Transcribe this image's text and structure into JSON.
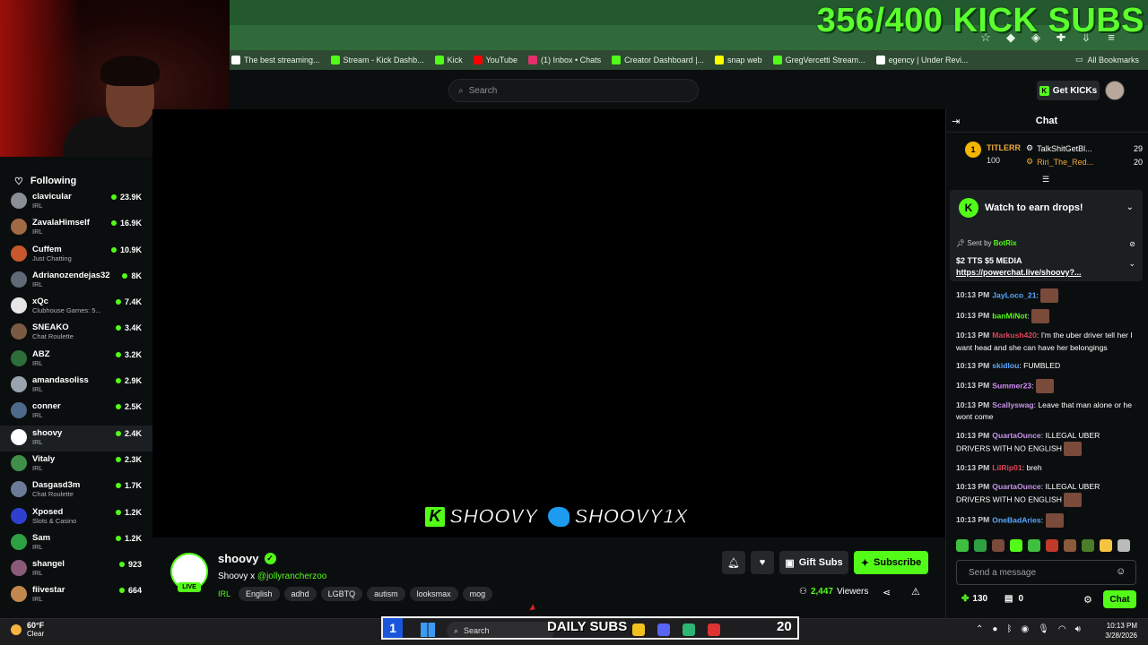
{
  "overlay": {
    "sub_counter": "356/400 KICK SUBS"
  },
  "bookmarks": [
    {
      "label": "The best streaming...",
      "color": "#ffffff"
    },
    {
      "label": "Stream - Kick Dashb...",
      "color": "#53fc18"
    },
    {
      "label": "Kick",
      "color": "#53fc18"
    },
    {
      "label": "YouTube",
      "color": "#ff0000"
    },
    {
      "label": "(1) Inbox • Chats",
      "color": "#e1306c"
    },
    {
      "label": "Creator Dashboard |...",
      "color": "#53fc18"
    },
    {
      "label": "snap web",
      "color": "#fffc00"
    },
    {
      "label": "GregVercetti Stream...",
      "color": "#53fc18"
    },
    {
      "label": "egency | Under Revi...",
      "color": "#ffffff"
    }
  ],
  "bookmarks_all": "All Bookmarks",
  "header": {
    "search_placeholder": "Search",
    "get_kicks": "Get KICKs"
  },
  "sidebar": {
    "heading": "Following",
    "items": [
      {
        "name": "clavicular",
        "category": "IRL",
        "viewers": "23.9K",
        "avatar": "#8a8f95"
      },
      {
        "name": "ZavalaHimself",
        "category": "IRL",
        "viewers": "16.9K",
        "avatar": "#a06a45"
      },
      {
        "name": "Cuffem",
        "category": "Just Chatting",
        "viewers": "10.9K",
        "avatar": "#c7582e"
      },
      {
        "name": "Adrianozendejas32",
        "category": "IRL",
        "viewers": "8K",
        "avatar": "#5e6b77"
      },
      {
        "name": "xQc",
        "category": "Clubhouse Games: 5...",
        "viewers": "7.4K",
        "avatar": "#e6e6e6"
      },
      {
        "name": "SNEAKO",
        "category": "Chat Roulette",
        "viewers": "3.4K",
        "avatar": "#7b5a44"
      },
      {
        "name": "ABZ",
        "category": "IRL",
        "viewers": "3.2K",
        "avatar": "#2d6d3a"
      },
      {
        "name": "amandasoliss",
        "category": "IRL",
        "viewers": "2.9K",
        "avatar": "#9aa3ad"
      },
      {
        "name": "conner",
        "category": "IRL",
        "viewers": "2.5K",
        "avatar": "#4d6a8a"
      },
      {
        "name": "shoovy",
        "category": "IRL",
        "viewers": "2.4K",
        "avatar": "#ffffff"
      },
      {
        "name": "Vitaly",
        "category": "IRL",
        "viewers": "2.3K",
        "avatar": "#3f8f4a"
      },
      {
        "name": "Dasgasd3m",
        "category": "Chat Roulette",
        "viewers": "1.7K",
        "avatar": "#6b7c9a"
      },
      {
        "name": "Xposed",
        "category": "Slots & Casino",
        "viewers": "1.2K",
        "avatar": "#2f3fd0"
      },
      {
        "name": "Sam",
        "category": "IRL",
        "viewers": "1.2K",
        "avatar": "#2ea043"
      },
      {
        "name": "shangel",
        "category": "IRL",
        "viewers": "923",
        "avatar": "#8a5a78"
      },
      {
        "name": "fiivestar",
        "category": "IRL",
        "viewers": "664",
        "avatar": "#c2874d"
      }
    ]
  },
  "video_overlay": {
    "kick_handle": "SHOOVY",
    "twitter_handle": "SHOOVY1X"
  },
  "stream": {
    "name": "shoovy",
    "live": "LIVE",
    "title_prefix": "Shoovy x ",
    "title_mention": "@jollyrancherzoo",
    "category": "IRL",
    "tags": [
      "English",
      "adhd",
      "LGBTQ",
      "autism",
      "looksmax",
      "mog"
    ],
    "viewers_count": "2,447",
    "viewers_label": "Viewers",
    "gift_subs": "Gift Subs",
    "subscribe": "Subscribe"
  },
  "chat": {
    "title": "Chat",
    "top_gifter": {
      "rank": "1",
      "name": "TITLERR",
      "amount": "100"
    },
    "gifters": [
      {
        "name": "TalkShitGetBl...",
        "count": "29",
        "color": "#ffffff"
      },
      {
        "name": "Riri_The_Red...",
        "count": "20",
        "color": "#f0a93b"
      }
    ],
    "drops_title": "Watch to earn drops!",
    "pinned_by_label": "Sent by",
    "pinned_by": "BotRix",
    "pinned_text": "$2 TTS $5 MEDIA",
    "pinned_link": "https://powerchat.live/shoovy?...",
    "messages": [
      {
        "time": "10:13 PM",
        "user": "JayLoco_21",
        "color": "#5aa8ff",
        "text": "",
        "emote": true
      },
      {
        "time": "10:13 PM",
        "user": "banMiNot",
        "color": "#53fc18",
        "text": "",
        "emote": true
      },
      {
        "time": "10:13 PM",
        "user": "Markush420",
        "color": "#e0445a",
        "text": "I'm the uber driver tell her I want head and she can have her belongings",
        "emote": false
      },
      {
        "time": "10:13 PM",
        "user": "skidlou",
        "color": "#5aa8ff",
        "text": "FUMBLED",
        "emote": false
      },
      {
        "time": "10:13 PM",
        "user": "Summer23",
        "color": "#d68cf5",
        "text": "",
        "emote": true
      },
      {
        "time": "10:13 PM",
        "user": "Scallyswag",
        "color": "#c792ea",
        "text": "Leave that man alone or he wont come",
        "emote": false
      },
      {
        "time": "10:13 PM",
        "user": "QuartaOunce",
        "color": "#c792ea",
        "text": "ILLEGAL UBER DRIVERS WITH NO ENGLISH",
        "emote": true
      },
      {
        "time": "10:13 PM",
        "user": "LilRip01",
        "color": "#e0445a",
        "text": "breh",
        "emote": false
      },
      {
        "time": "10:13 PM",
        "user": "QuartaOunce",
        "color": "#c792ea",
        "text": "ILLEGAL UBER DRIVERS WITH NO ENGLISH",
        "emote": true
      },
      {
        "time": "10:13 PM",
        "user": "OneBadAries",
        "color": "#5aa8ff",
        "text": "",
        "emote": true
      }
    ],
    "input_placeholder": "Send a message",
    "kicks": "130",
    "store": "0",
    "send": "Chat"
  },
  "taskbar": {
    "temp": "60°F",
    "weather": "Clear",
    "search": "Search",
    "daily_subs_count": "1",
    "daily_subs_label": "DAILY SUBS",
    "daily_subs_goal": "20",
    "time": "10:13 PM",
    "date": "3/28/2026"
  }
}
